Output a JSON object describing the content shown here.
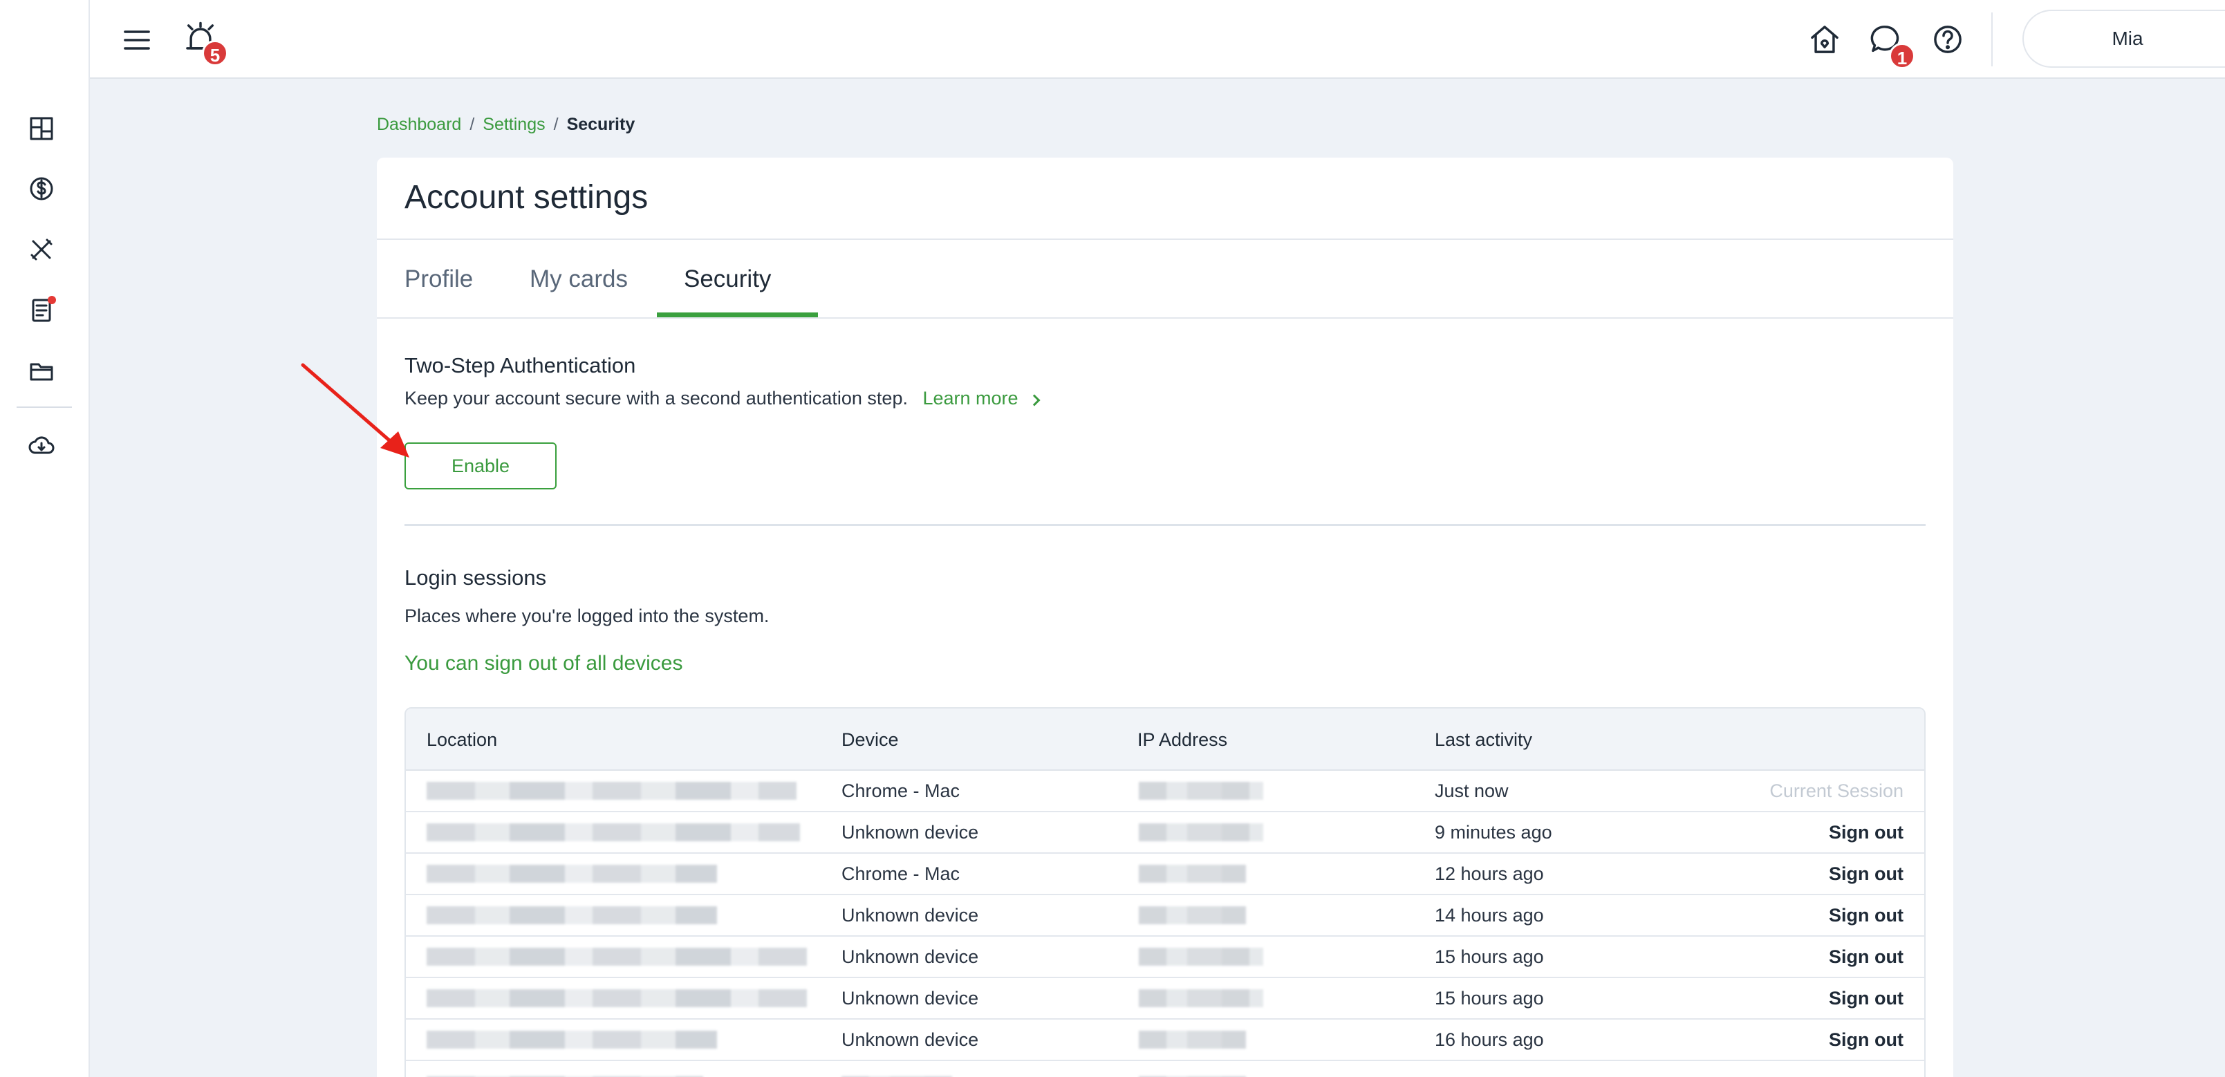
{
  "topbar": {
    "alerts_badge": "5",
    "messages_badge": "1",
    "user_name": "Mia"
  },
  "breadcrumb": {
    "items": [
      "Dashboard",
      "Settings"
    ],
    "current": "Security",
    "separator": "/"
  },
  "card": {
    "title": "Account settings",
    "tabs": [
      {
        "label": "Profile"
      },
      {
        "label": "My cards"
      },
      {
        "label": "Security",
        "active": true
      }
    ]
  },
  "two_step": {
    "title": "Two-Step Authentication",
    "description": "Keep your account secure with a second authentication step.",
    "learn_more": "Learn more",
    "enable_label": "Enable"
  },
  "sessions": {
    "title": "Login sessions",
    "description": "Places where you're logged into the system.",
    "sign_out_all": "You can sign out of all devices",
    "columns": [
      "Location",
      "Device",
      "IP Address",
      "Last activity"
    ],
    "rows": [
      {
        "device": "Chrome - Mac",
        "activity": "Just now",
        "action": "Current Session"
      },
      {
        "device": "Unknown device",
        "activity": "9 minutes ago",
        "action": "Sign out"
      },
      {
        "device": "Chrome - Mac",
        "activity": "12 hours ago",
        "action": "Sign out"
      },
      {
        "device": "Unknown device",
        "activity": "14 hours ago",
        "action": "Sign out"
      },
      {
        "device": "Unknown device",
        "activity": "15 hours ago",
        "action": "Sign out"
      },
      {
        "device": "Unknown device",
        "activity": "15 hours ago",
        "action": "Sign out"
      },
      {
        "device": "Unknown device",
        "activity": "16 hours ago",
        "action": "Sign out"
      }
    ]
  },
  "colors": {
    "accent_green": "#3aa03e",
    "badge_red": "#d93a3a",
    "annotation_red": "#e8221a",
    "background": "#eef2f7"
  },
  "icons": {
    "sidebar": [
      "dashboard-grid-icon",
      "dollar-circle-icon",
      "tools-icon",
      "document-icon",
      "folder-icon",
      "cloud-download-icon"
    ],
    "topbar": [
      "menu-icon",
      "alarm-icon",
      "home-icon",
      "chat-icon",
      "help-icon"
    ]
  }
}
